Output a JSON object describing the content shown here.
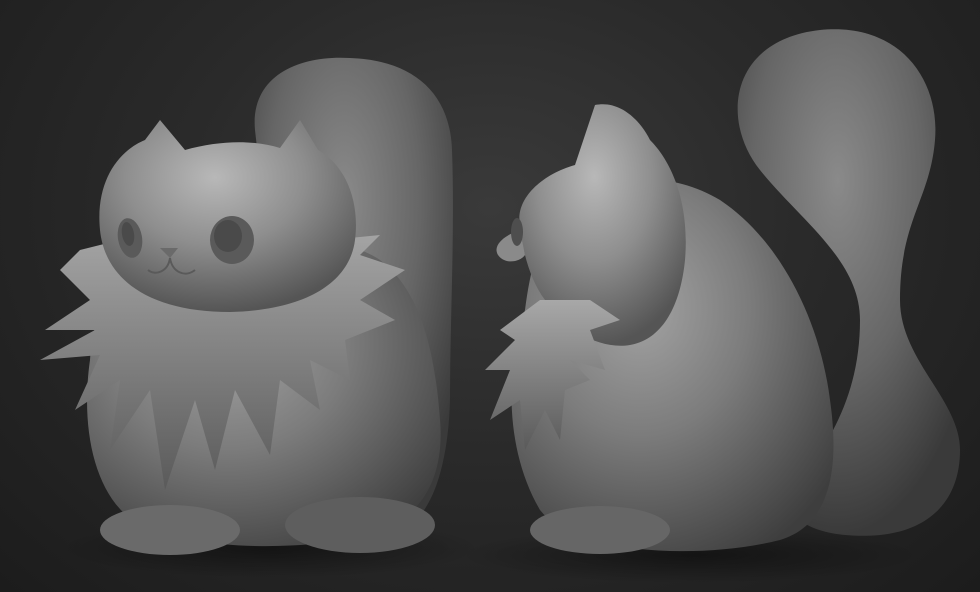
{
  "scene": {
    "views": [
      "front-view",
      "side-view"
    ]
  },
  "colors": {
    "background_top": "#3a3a3a",
    "background_bottom": "#1c1c1c",
    "clay_light": "#9a9a9a",
    "clay_mid": "#6e6e6e",
    "clay_dark": "#3c3c3c"
  }
}
